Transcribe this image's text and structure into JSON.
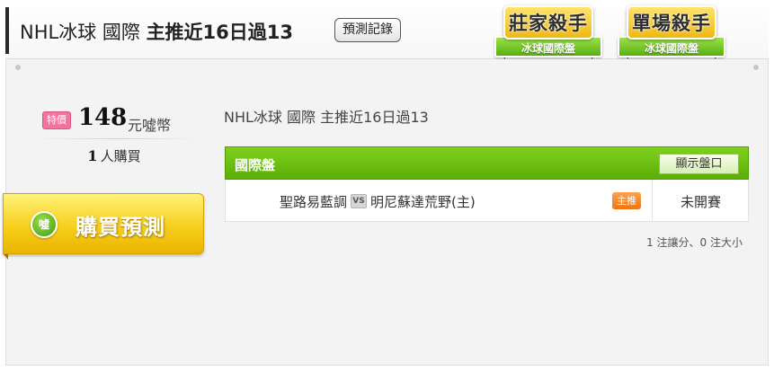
{
  "header": {
    "title_normal": "NHL冰球 國際 ",
    "title_strong": "主推近16日過13",
    "record_button": "預測記錄",
    "badges": [
      {
        "title": "莊家殺手",
        "subtitle": "冰球國際盤"
      },
      {
        "title": "單場殺手",
        "subtitle": "冰球國際盤"
      }
    ]
  },
  "sidebar": {
    "price_tag": "特價",
    "price": "148",
    "price_unit": "元噓幣",
    "buyers_count": "1",
    "buyers_label": "人購買",
    "buy_icon": "噓",
    "buy_button": "購買預測"
  },
  "main": {
    "subtitle": "NHL冰球 國際 主推近16日過13",
    "table": {
      "header_label": "國際盤",
      "show_button": "顯示盤口",
      "rows": [
        {
          "away": "聖路易藍調",
          "vs": "VS",
          "home": "明尼蘇達荒野(主)",
          "tag": "主推",
          "status": "未開賽"
        }
      ]
    },
    "summary": "1 注讓分、0 注大小"
  },
  "colors": {
    "green_header": "#5cae08",
    "buy_yellow": "#f7cf1c",
    "price_tag_pink": "#f2739c",
    "home_tag_orange": "#ef7414"
  }
}
